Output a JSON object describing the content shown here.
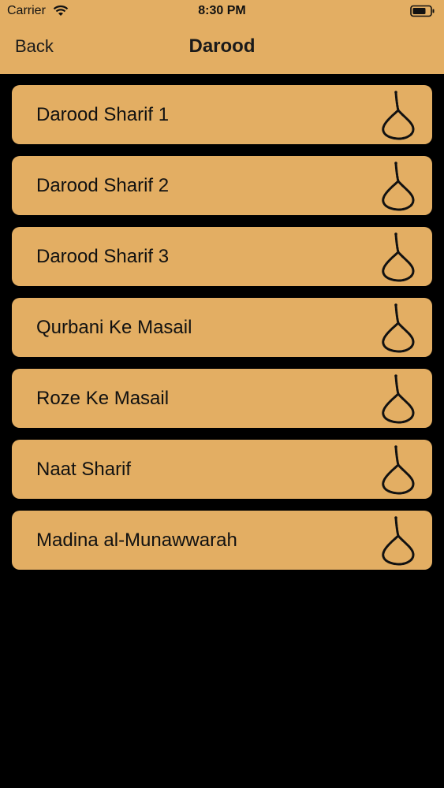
{
  "status_bar": {
    "carrier": "Carrier",
    "time": "8:30 PM",
    "wifi_icon": "wifi-icon",
    "battery_icon": "battery-icon"
  },
  "nav": {
    "back_label": "Back",
    "title": "Darood"
  },
  "items": [
    {
      "label": "Darood Sharif 1",
      "icon": "prayer-beads-icon"
    },
    {
      "label": "Darood Sharif 2",
      "icon": "prayer-beads-icon"
    },
    {
      "label": "Darood Sharif 3",
      "icon": "prayer-beads-icon"
    },
    {
      "label": "Qurbani Ke Masail",
      "icon": "prayer-beads-icon"
    },
    {
      "label": "Roze Ke Masail",
      "icon": "prayer-beads-icon"
    },
    {
      "label": "Naat Sharif",
      "icon": "prayer-beads-icon"
    },
    {
      "label": "Madina al-Munawwarah",
      "icon": "prayer-beads-icon"
    }
  ],
  "colors": {
    "accent": "#E3AE63",
    "background": "#000000",
    "text": "#111111"
  }
}
